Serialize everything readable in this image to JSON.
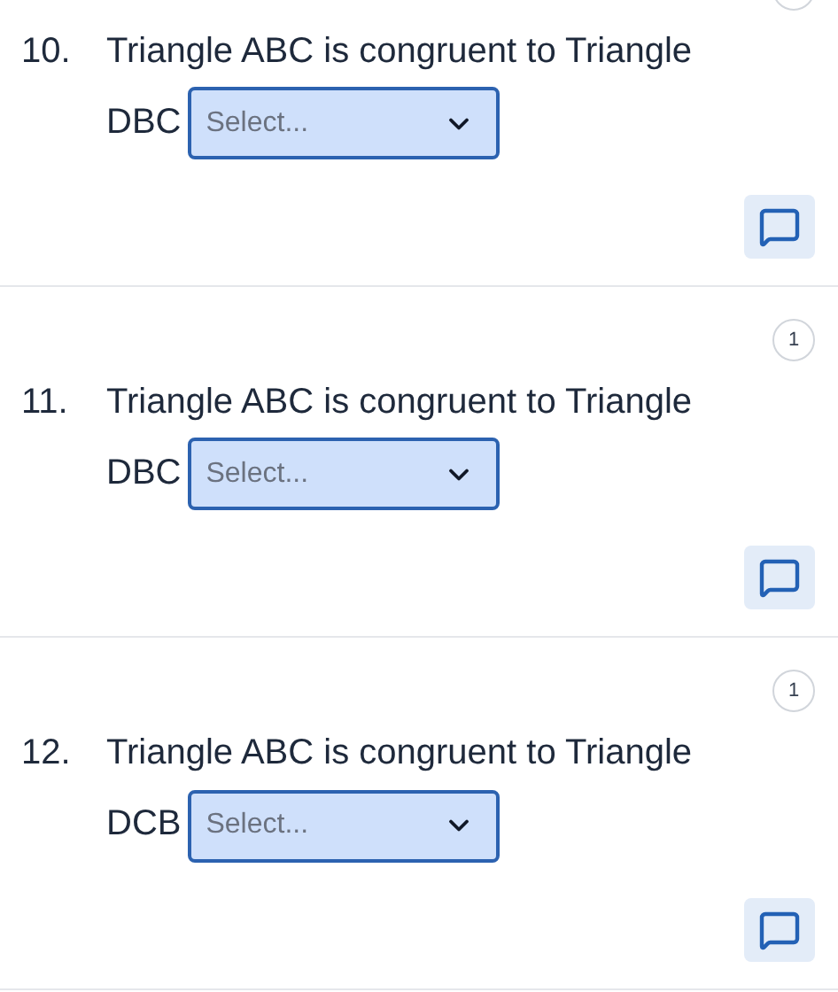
{
  "questions": [
    {
      "number": "10.",
      "text": "Triangle ABC is congruent to Triangle DBC",
      "badge_partial": true,
      "select": {
        "placeholder": "Select..."
      }
    },
    {
      "number": "11.",
      "text": "Triangle ABC is congruent to Triangle DBC",
      "badge": "1",
      "select": {
        "placeholder": "Select..."
      }
    },
    {
      "number": "12.",
      "text": "Triangle ABC is congruent to Triangle DCB",
      "badge": "1",
      "select": {
        "placeholder": "Select..."
      }
    }
  ]
}
